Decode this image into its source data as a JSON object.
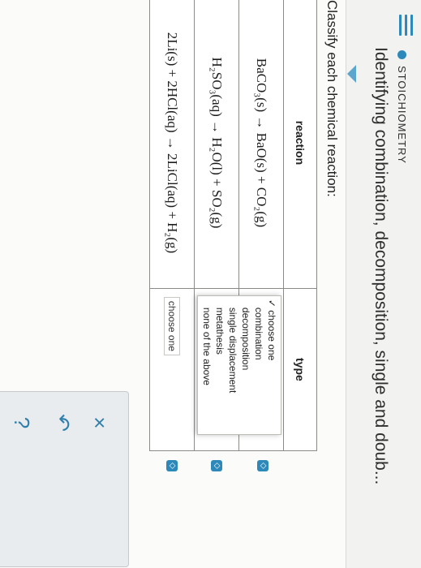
{
  "header": {
    "topic": "STOICHIOMETRY",
    "title": "Identifying combination, decomposition, single and doub..."
  },
  "instruction": "Classify each chemical reaction:",
  "table": {
    "headers": {
      "reaction": "reaction",
      "type": "type"
    },
    "rows": [
      {
        "reaction_html": "BaCO₃(s) → BaO(s) + CO₂(g)",
        "type": "choose one",
        "expanded": true
      },
      {
        "reaction_html": "H₂SO₃(aq) → H₂O(l) + SO₂(g)",
        "type": "choose one",
        "expanded": false
      },
      {
        "reaction_html": "2Li(s) + 2HCl(aq) → 2LiCl(aq) + H₂(g)",
        "type": "choose one",
        "expanded": false
      }
    ]
  },
  "dropdown": {
    "selected": "choose one",
    "options": [
      "combination",
      "decomposition",
      "single displacement",
      "metathesis",
      "none of the above"
    ]
  },
  "actions": {
    "close": "×",
    "undo": "↶",
    "help": "?"
  },
  "colors": {
    "accent": "#2d89b9"
  }
}
